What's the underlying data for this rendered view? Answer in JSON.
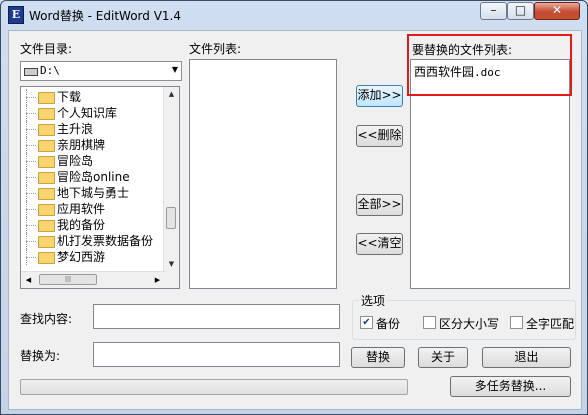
{
  "window": {
    "title": "Word替换 - EditWord V1.4",
    "app_icon_glyph": "E",
    "controls": {
      "minimize": "–",
      "maximize": "□",
      "close": "✕"
    }
  },
  "left_panel": {
    "dir_label": "文件目录:",
    "drive_value": "D:\\",
    "tree_items": [
      "下载",
      "个人知识库",
      "主升浪",
      "亲朋棋牌",
      "冒险岛",
      "冒险岛online",
      "地下城与勇士",
      "应用软件",
      "我的备份",
      "机打发票数据备份",
      "梦幻西游"
    ],
    "scroll_grip": "|||"
  },
  "middle_panel": {
    "list_label": "文件列表:"
  },
  "buttons": {
    "add": "添加>>",
    "remove": "<<删除",
    "add_all": "全部>>",
    "clear": "<<清空",
    "replace": "替换",
    "about": "关于",
    "exit": "退出",
    "multitask": "多任务替换..."
  },
  "right_panel": {
    "list_label": "要替换的文件列表:",
    "files": [
      {
        "name": "西西软件园",
        "ext": ".doc"
      }
    ]
  },
  "fields": {
    "find_label": "查找内容:",
    "find_value": "",
    "replace_label": "替换为:",
    "replace_value": ""
  },
  "options": {
    "group_label": "选项",
    "backup": {
      "label": "备份",
      "checked": true
    },
    "match_case": {
      "label": "区分大小写",
      "checked": false
    },
    "whole_word": {
      "label": "全字匹配",
      "checked": false
    }
  },
  "progress": {
    "value": 0
  },
  "colors": {
    "highlight_box": "#e31b1b",
    "folder": "#f6d66c"
  }
}
